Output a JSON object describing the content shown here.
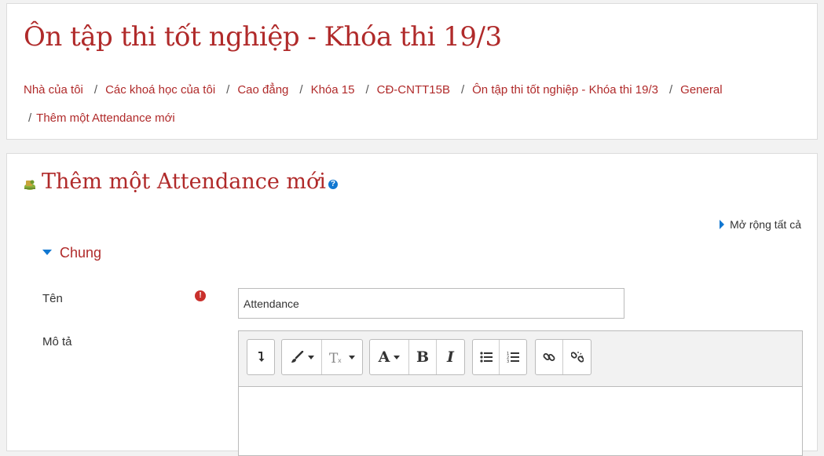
{
  "header": {
    "title": "Ôn tập thi tốt nghiệp - Khóa thi 19/3",
    "breadcrumb": [
      "Nhà của tôi",
      "Các khoá học của tôi",
      "Cao đẳng",
      "Khóa 15",
      "CĐ-CNTT15B",
      "Ôn tập thi tốt nghiệp - Khóa thi 19/3",
      "General",
      "Thêm một Attendance mới"
    ],
    "separator": "/"
  },
  "main": {
    "title": "Thêm một Attendance mới",
    "expand_all": "Mở rộng tất cả",
    "section": "Chung",
    "fields": {
      "name_label": "Tên",
      "name_value": "Attendance",
      "description_label": "Mô tả"
    }
  },
  "toolbar": {
    "buttons": [
      "toggle-toolbar-icon",
      "paintbrush-icon",
      "text-style-icon",
      "font-color-icon",
      "bold-icon",
      "italic-icon",
      "bulleted-list-icon",
      "numbered-list-icon",
      "link-icon",
      "unlink-icon"
    ],
    "bold_glyph": "B",
    "italic_glyph": "I",
    "font_glyph": "A"
  },
  "colors": {
    "accent_red": "#b02a2a",
    "accent_blue": "#1177d1",
    "required_red": "#c9302c"
  }
}
